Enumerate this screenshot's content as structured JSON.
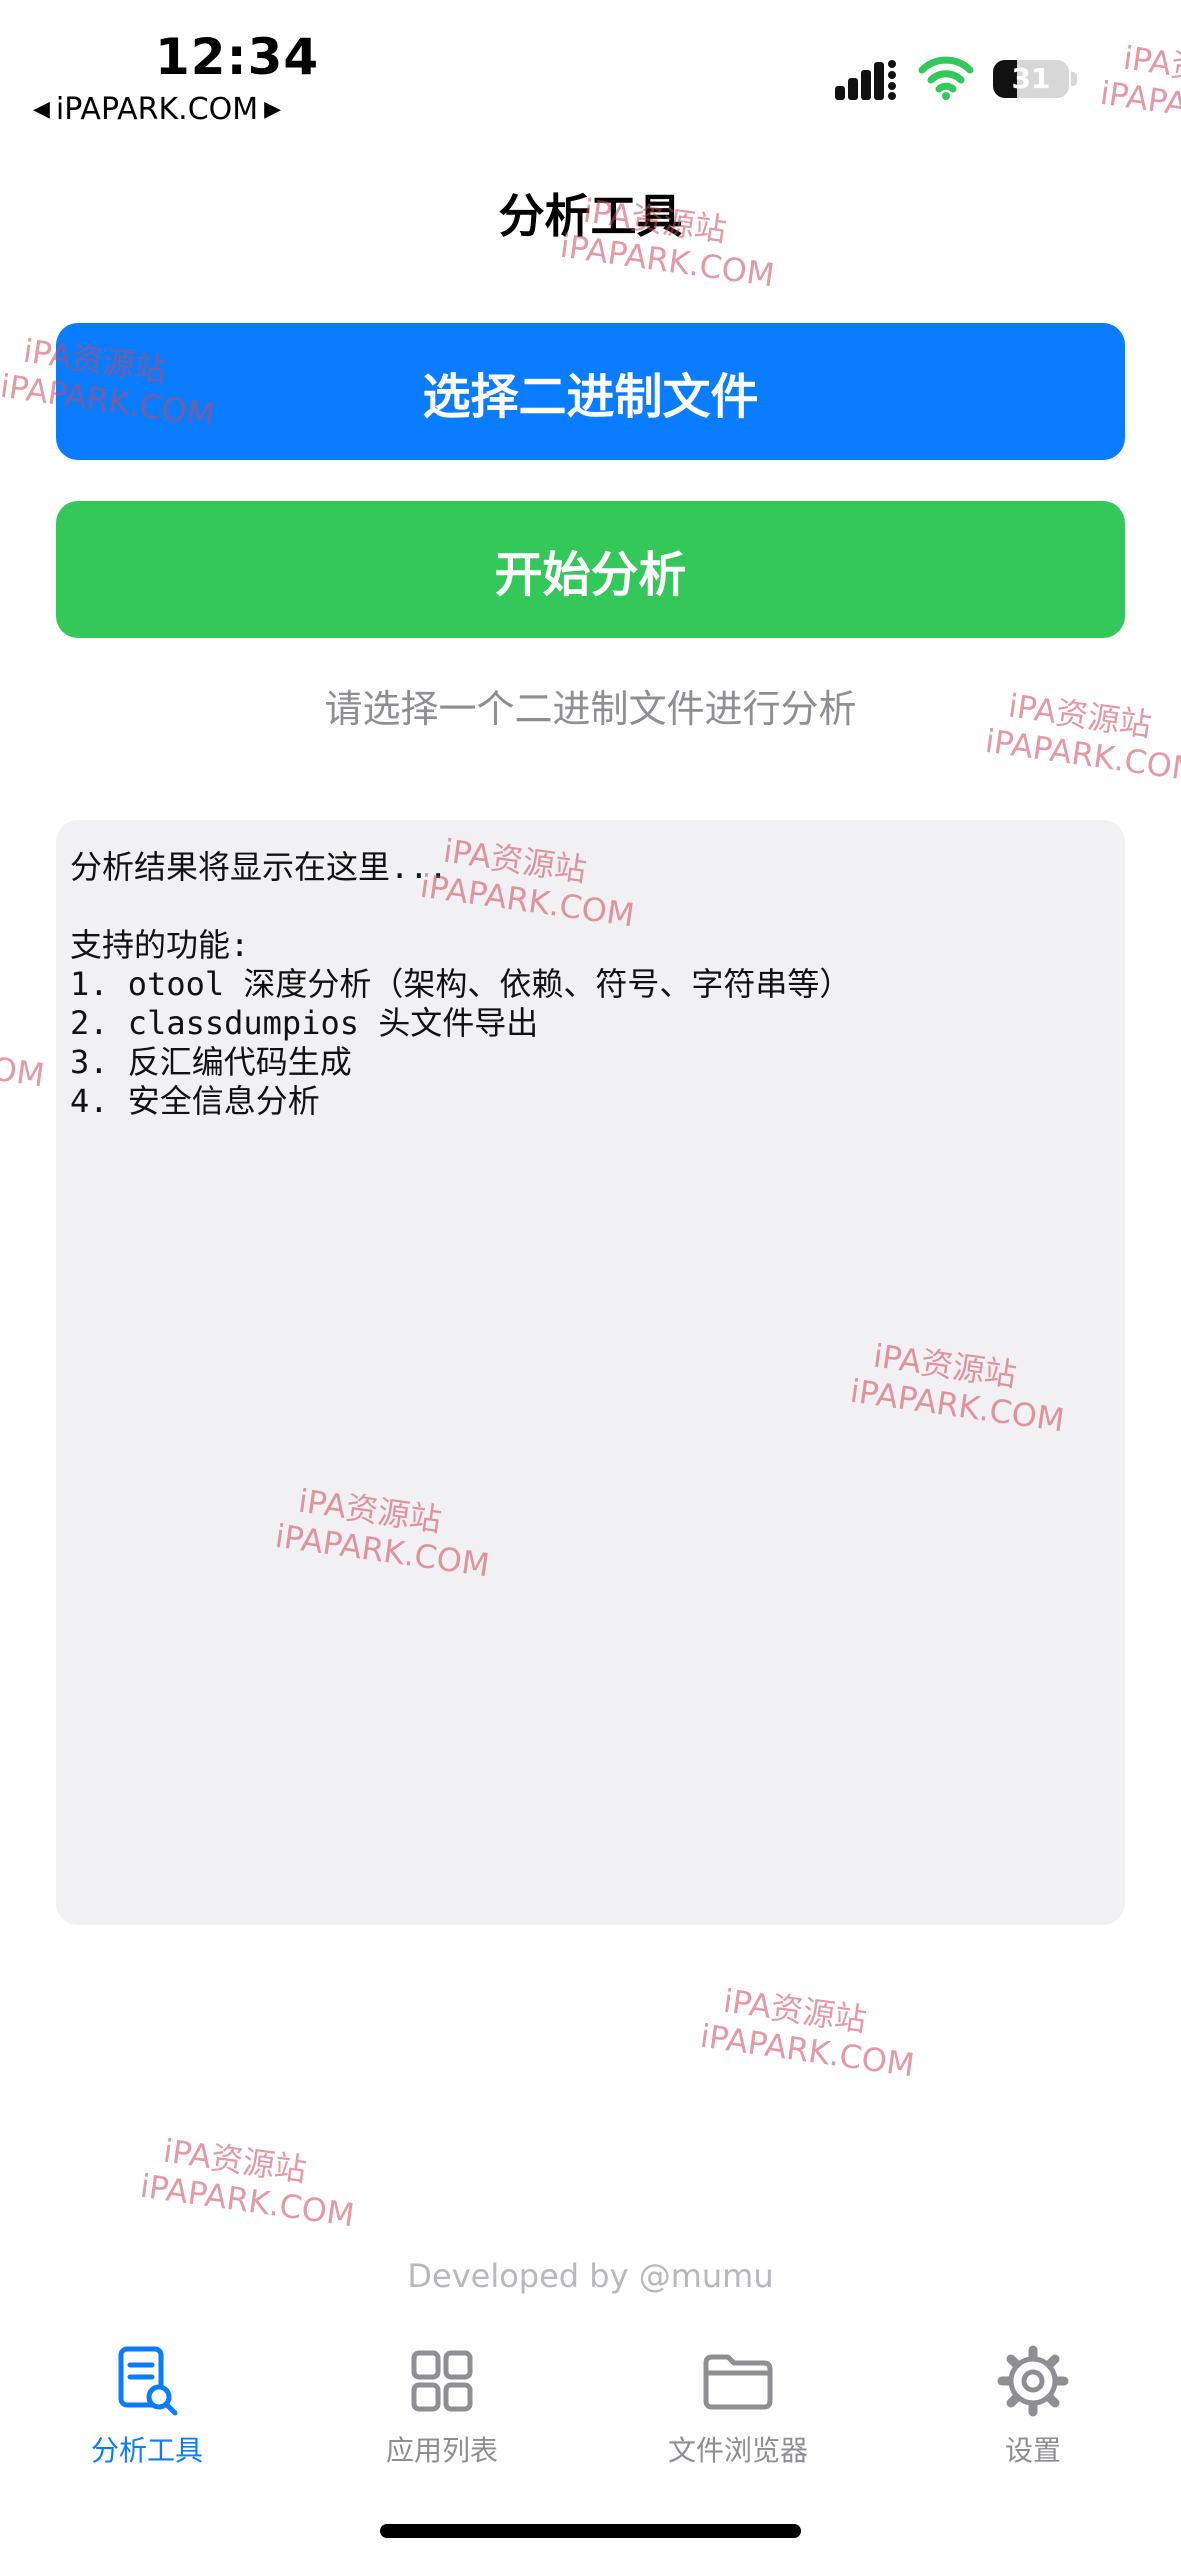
{
  "status_bar": {
    "time": "12:34",
    "back_app": "iPAPARK.COM",
    "battery_level": "31",
    "battery_fraction": 0.31
  },
  "header": {
    "title": "分析工具"
  },
  "buttons": {
    "select_binary": "选择二进制文件",
    "start_analysis": "开始分析"
  },
  "status_text": "请选择一个二进制文件进行分析",
  "result": {
    "lines": [
      "分析结果将显示在这里...",
      "",
      "支持的功能:",
      "1. otool 深度分析（架构、依赖、符号、字符串等）",
      "2. classdumpios 头文件导出",
      "3. 反汇编代码生成",
      "4. 安全信息分析"
    ]
  },
  "footer": {
    "developer": "Developed by @mumu"
  },
  "tab_bar": {
    "active_index": 0,
    "tabs": [
      {
        "label": "分析工具",
        "icon": "doc-search-icon"
      },
      {
        "label": "应用列表",
        "icon": "grid-icon"
      },
      {
        "label": "文件浏览器",
        "icon": "folder-icon"
      },
      {
        "label": "设置",
        "icon": "gear-icon"
      }
    ]
  },
  "watermark": {
    "line1": "iPA资源站",
    "line2": "iPAPARK.COM"
  },
  "colors": {
    "select_button": "#0a7cff",
    "analyze_button": "#34c759",
    "tab_active": "#0a7cff",
    "tab_inactive": "#8e8e93",
    "wifi": "#34c759",
    "watermark": "#cd465a"
  }
}
